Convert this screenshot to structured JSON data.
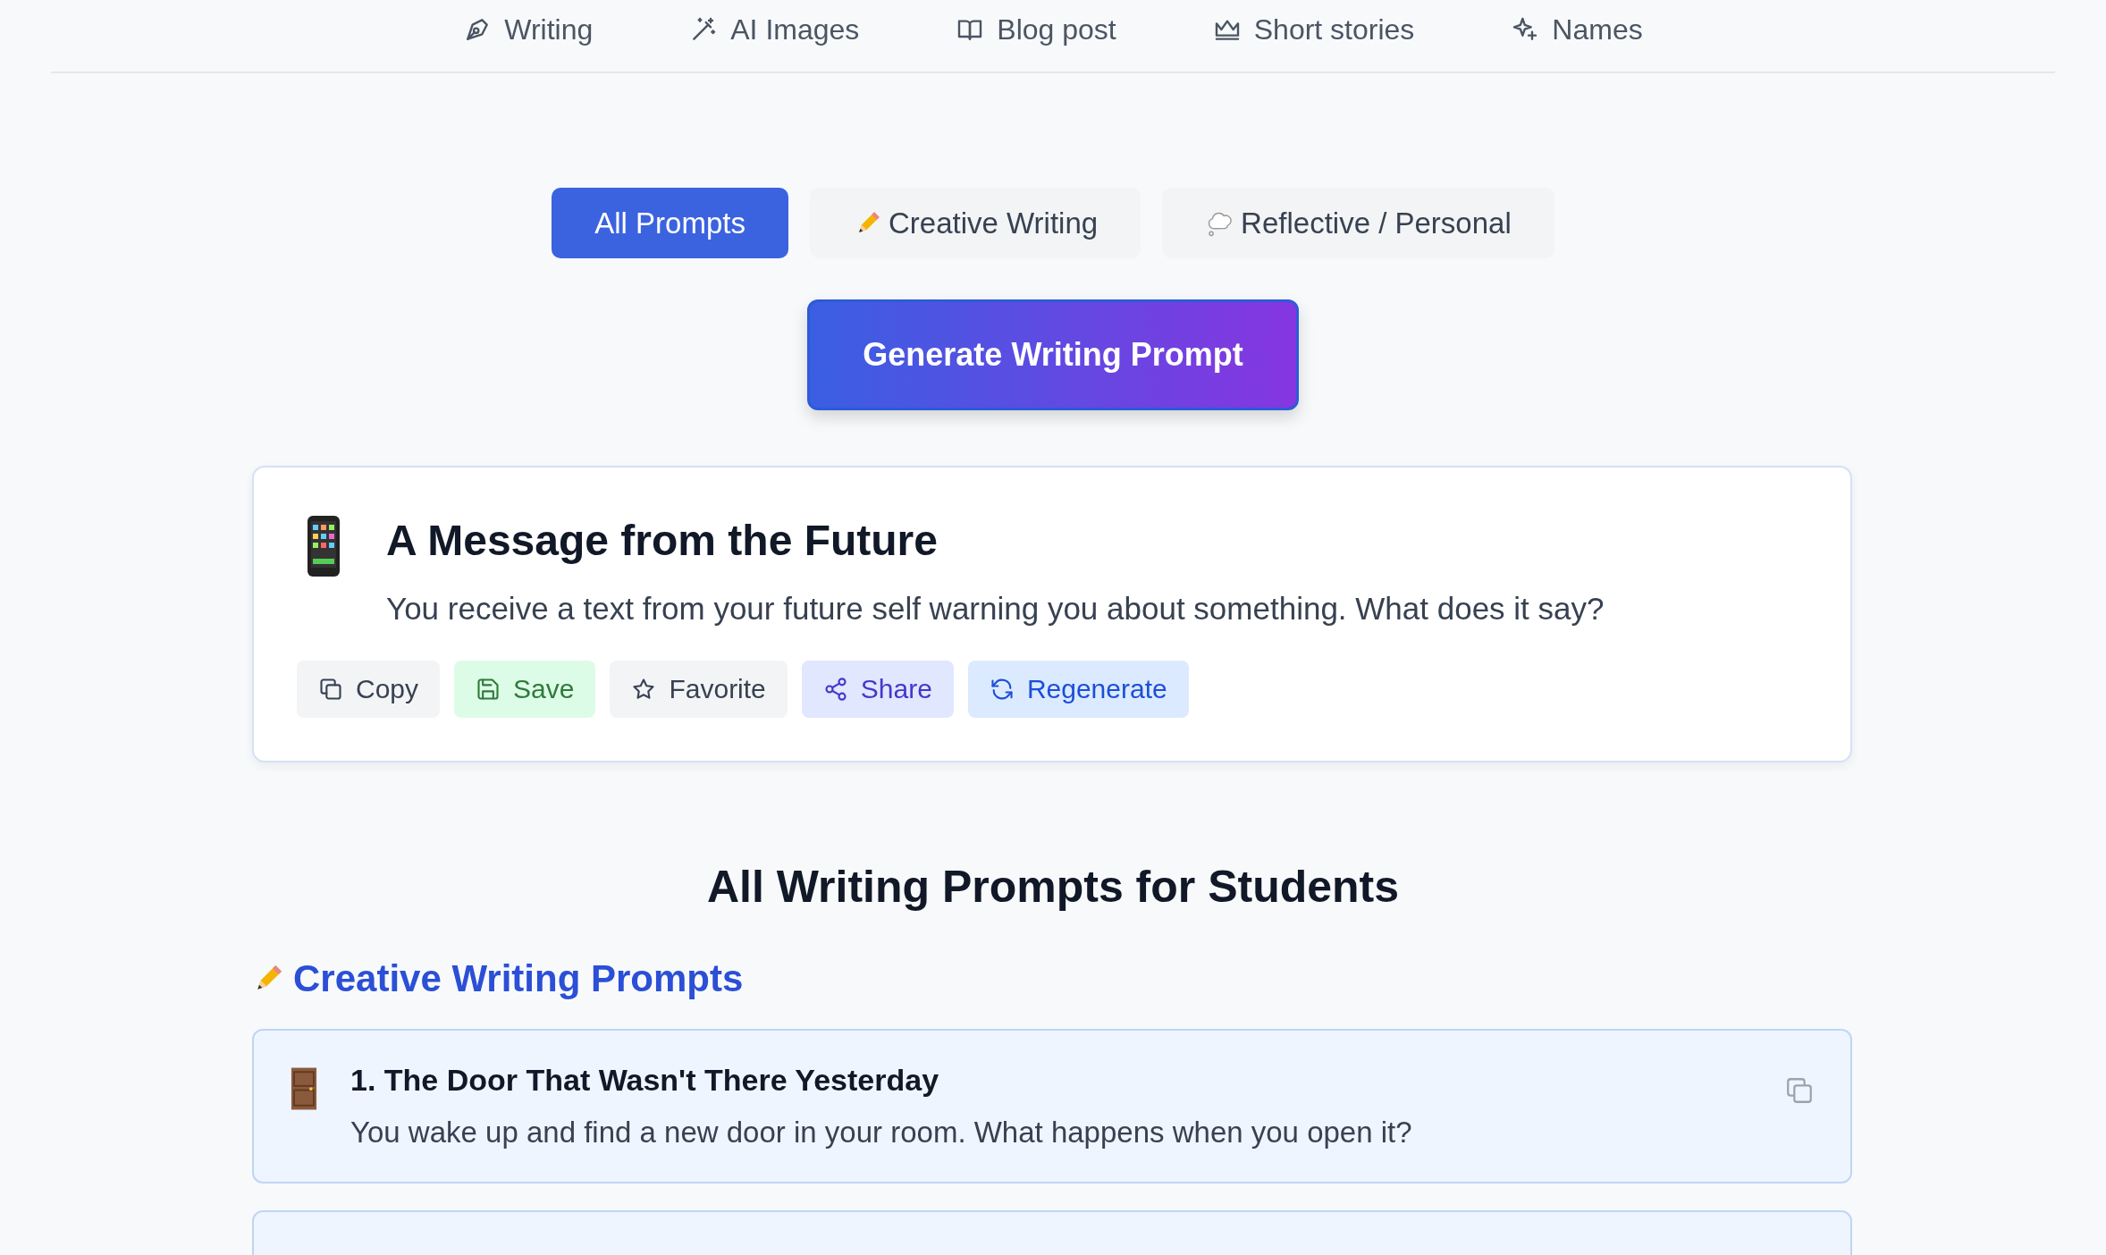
{
  "nav": [
    {
      "label": "Writing"
    },
    {
      "label": "AI Images"
    },
    {
      "label": "Blog post"
    },
    {
      "label": "Short stories"
    },
    {
      "label": "Names"
    }
  ],
  "filters": [
    {
      "label": "All Prompts",
      "selected": true
    },
    {
      "label": "Creative Writing",
      "selected": false
    },
    {
      "label": "Reflective / Personal",
      "selected": false
    }
  ],
  "generate_button": "Generate Writing Prompt",
  "prompt_card": {
    "title": "A Message from the Future",
    "text": "You receive a text from your future self warning you about something. What does it say?",
    "actions": [
      {
        "label": "Copy",
        "kind": "copy"
      },
      {
        "label": "Save",
        "kind": "save"
      },
      {
        "label": "Favorite",
        "kind": "favorite"
      },
      {
        "label": "Share",
        "kind": "share"
      },
      {
        "label": "Regenerate",
        "kind": "regenerate"
      }
    ]
  },
  "list_heading": "All Writing Prompts for Students",
  "section": {
    "title": "Creative Writing Prompts",
    "items": [
      {
        "title": "1. The Door That Wasn't There Yesterday",
        "text": "You wake up and find a new door in your room. What happens when you open it?"
      }
    ]
  }
}
